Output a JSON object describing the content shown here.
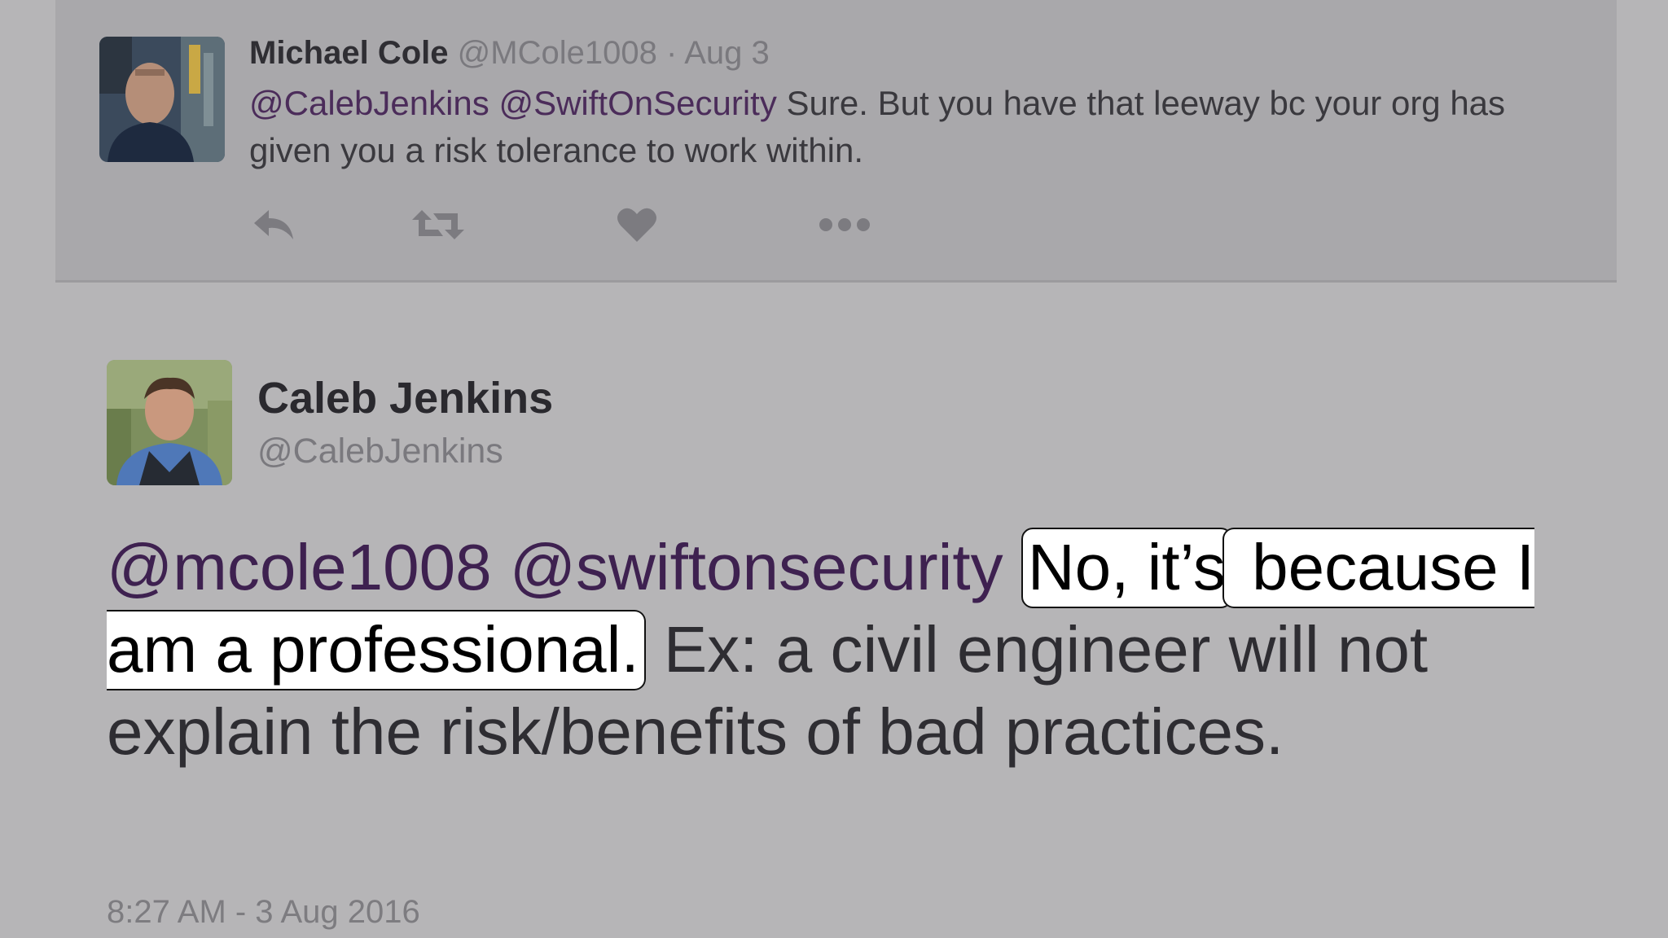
{
  "reply_tweet": {
    "author_name": "Michael Cole",
    "author_handle": "@MCole1008",
    "separator": "·",
    "date": "Aug 3",
    "mention_1": "@CalebJenkins",
    "mention_2": "@SwiftOnSecurity",
    "text": "Sure. But you have that leeway bc your org has given you a risk tolerance to work within.",
    "actions": {
      "reply_icon": "reply-icon",
      "retweet_icon": "retweet-icon",
      "like_icon": "heart-icon",
      "more_icon": "more-icon"
    }
  },
  "main_tweet": {
    "author_name": "Caleb Jenkins",
    "author_handle": "@CalebJenkins",
    "mention_1": "@mcole1008",
    "mention_2": "@swiftonsecurity",
    "highlight_1": "No, it’s",
    "highlight_2": "because I am a professional.",
    "text_rest": "Ex: a civil engineer will not explain the risk/benefits of bad practices.",
    "timestamp": "8:27 AM - 3 Aug 2016"
  },
  "colors": {
    "background": "#b6b5b7",
    "card": "#a9a8ab",
    "mention": "#3e2150",
    "highlight": "#ffffff"
  }
}
